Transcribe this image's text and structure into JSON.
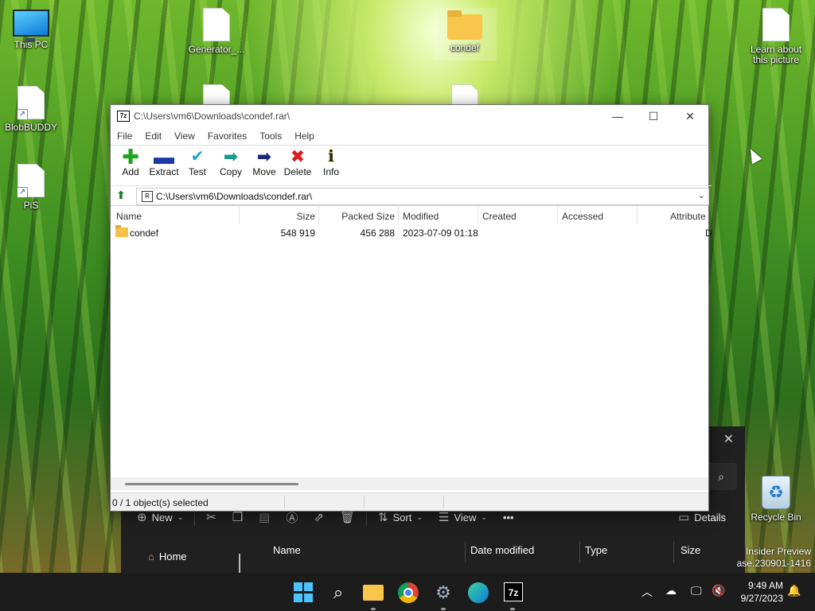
{
  "desktop": {
    "icons": [
      {
        "label": "This PC"
      },
      {
        "label": "Generator_..."
      },
      {
        "label": "condef"
      },
      {
        "label": "Learn about this picture"
      },
      {
        "label": "BlobBUDDY"
      },
      {
        "label": "PiS"
      },
      {
        "label": "Recycle Bin"
      }
    ],
    "watermark_line1": "Insider Preview",
    "watermark_line2": "ase.230901-1416"
  },
  "sevenzip": {
    "title": "C:\\Users\\vm6\\Downloads\\condef.rar\\",
    "menu": [
      "File",
      "Edit",
      "View",
      "Favorites",
      "Tools",
      "Help"
    ],
    "toolbar": [
      "Add",
      "Extract",
      "Test",
      "Copy",
      "Move",
      "Delete",
      "Info"
    ],
    "address": "C:\\Users\\vm6\\Downloads\\condef.rar\\",
    "columns": [
      "Name",
      "Size",
      "Packed Size",
      "Modified",
      "Created",
      "Accessed",
      "Attribute"
    ],
    "rows": [
      {
        "name": "condef",
        "size": "548 919",
        "packed": "456 288",
        "modified": "2023-07-09 01:18",
        "created": "",
        "accessed": "",
        "attribute": "D"
      }
    ],
    "status": "0 / 1 object(s) selected"
  },
  "explorer": {
    "commands": {
      "new": "New",
      "sort": "Sort",
      "view": "View",
      "details": "Details"
    },
    "nav_home": "Home",
    "columns": [
      "Name",
      "Date modified",
      "Type",
      "Size"
    ]
  },
  "taskbar": {
    "time": "9:49 AM",
    "date": "9/27/2023",
    "apps": [
      "start-icon",
      "search-icon",
      "file-explorer-icon",
      "chrome-icon",
      "settings-icon",
      "edge-icon",
      "7zip-icon"
    ]
  },
  "colors": {
    "start_accent": "#4cc2ff",
    "folder": "#f7c64a",
    "add_green": "#1ea51e",
    "delete_red": "#d81e1e",
    "move_navy": "#1b2a7a"
  }
}
